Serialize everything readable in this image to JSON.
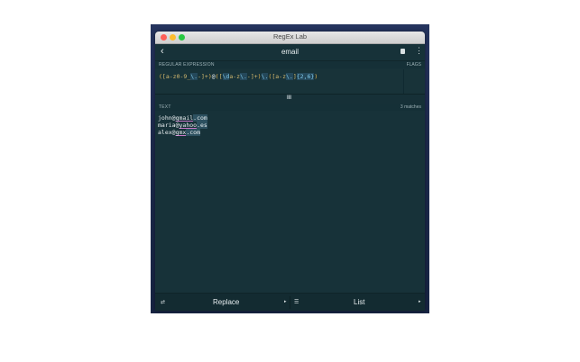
{
  "window": {
    "title": "RegEx Lab"
  },
  "nav": {
    "back_icon": "chevron-left-icon",
    "title": "email",
    "book_icon": "book-icon",
    "more_icon": "more-vertical-icon"
  },
  "regex_section": {
    "label": "REGULAR EXPRESSION",
    "flags_label": "FLAGS"
  },
  "regex": {
    "tokens": [
      {
        "text": "(",
        "color": "#e6b450"
      },
      {
        "text": "[a-z0-9_",
        "color": "#d3b96f"
      },
      {
        "text": "\\.",
        "color": "#7fc8e8"
      },
      {
        "text": "-]+",
        "color": "#d3b96f"
      },
      {
        "text": ")",
        "color": "#e6b450"
      },
      {
        "text": "@",
        "color": "#e8eef0"
      },
      {
        "text": "(",
        "color": "#e6b450"
      },
      {
        "text": "[",
        "color": "#d3b96f"
      },
      {
        "text": "\\d",
        "color": "#7fc8e8"
      },
      {
        "text": "a-z",
        "color": "#d3b96f"
      },
      {
        "text": "\\.",
        "color": "#7fc8e8"
      },
      {
        "text": "-]+",
        "color": "#d3b96f"
      },
      {
        "text": ")",
        "color": "#e6b450"
      },
      {
        "text": "\\.",
        "color": "#7fc8e8"
      },
      {
        "text": "(",
        "color": "#e6b450"
      },
      {
        "text": "[a-z",
        "color": "#d3b96f"
      },
      {
        "text": "\\.",
        "color": "#7fc8e8"
      },
      {
        "text": "]",
        "color": "#d3b96f"
      },
      {
        "text": "{2,6}",
        "color": "#7fc8e8"
      },
      {
        "text": ")",
        "color": "#e6b450"
      }
    ]
  },
  "divider": {
    "grip": "III"
  },
  "text_section": {
    "label": "TEXT",
    "match_count": "3 matches"
  },
  "text_lines": [
    {
      "user": "john",
      "at": "@",
      "domain": "gmail",
      "tld": ".com"
    },
    {
      "user": "maria",
      "at": "@",
      "domain": "yahoo",
      "tld": ".es"
    },
    {
      "user": "alex",
      "at": "@",
      "domain": "gmx",
      "tld": ".com"
    }
  ],
  "bottom": {
    "replace_icon": "replace-icon",
    "replace_label": "Replace",
    "list_icon": "list-icon",
    "list_label": "List",
    "arrow": "▸"
  }
}
